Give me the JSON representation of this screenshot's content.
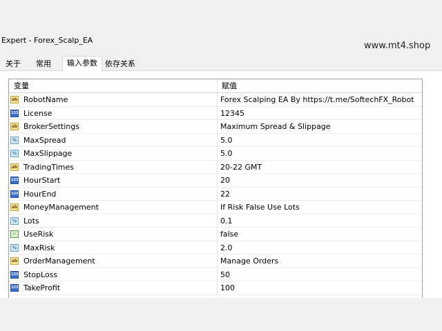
{
  "window": {
    "title": "Expert - Forex_Scalp_EA"
  },
  "watermark": "www.mt4.shop",
  "tabs": [
    {
      "label": "关于"
    },
    {
      "label": "常用"
    },
    {
      "label": "输入参数",
      "active": true
    },
    {
      "label": "依存关系"
    }
  ],
  "table": {
    "headers": {
      "variable": "变量",
      "value": "赋值"
    },
    "rows": [
      {
        "icon": "ab",
        "name": "RobotName",
        "value": "Forex Scalping EA By https://t.me/SoftechFX_Robot"
      },
      {
        "icon": "123",
        "name": "License",
        "value": "12345"
      },
      {
        "icon": "ab",
        "name": "BrokerSettings",
        "value": "Maximum Spread & Slippage"
      },
      {
        "icon": "frac",
        "name": "MaxSpread",
        "value": "5.0"
      },
      {
        "icon": "frac",
        "name": "MaxSlippage",
        "value": "5.0"
      },
      {
        "icon": "ab",
        "name": "TradingTimes",
        "value": "20-22 GMT"
      },
      {
        "icon": "123",
        "name": "HourStart",
        "value": "20"
      },
      {
        "icon": "123",
        "name": "HourEnd",
        "value": "22"
      },
      {
        "icon": "ab",
        "name": "MoneyManagement",
        "value": "If Risk False Use Lots"
      },
      {
        "icon": "frac",
        "name": "Lots",
        "value": "0.1"
      },
      {
        "icon": "bool",
        "name": "UseRisk",
        "value": "false"
      },
      {
        "icon": "frac",
        "name": "MaxRisk",
        "value": "2.0"
      },
      {
        "icon": "ab",
        "name": "OrderManagement",
        "value": "Manage Orders"
      },
      {
        "icon": "123",
        "name": "StopLoss",
        "value": "50"
      },
      {
        "icon": "123",
        "name": "TakeProfit",
        "value": "100"
      }
    ]
  }
}
